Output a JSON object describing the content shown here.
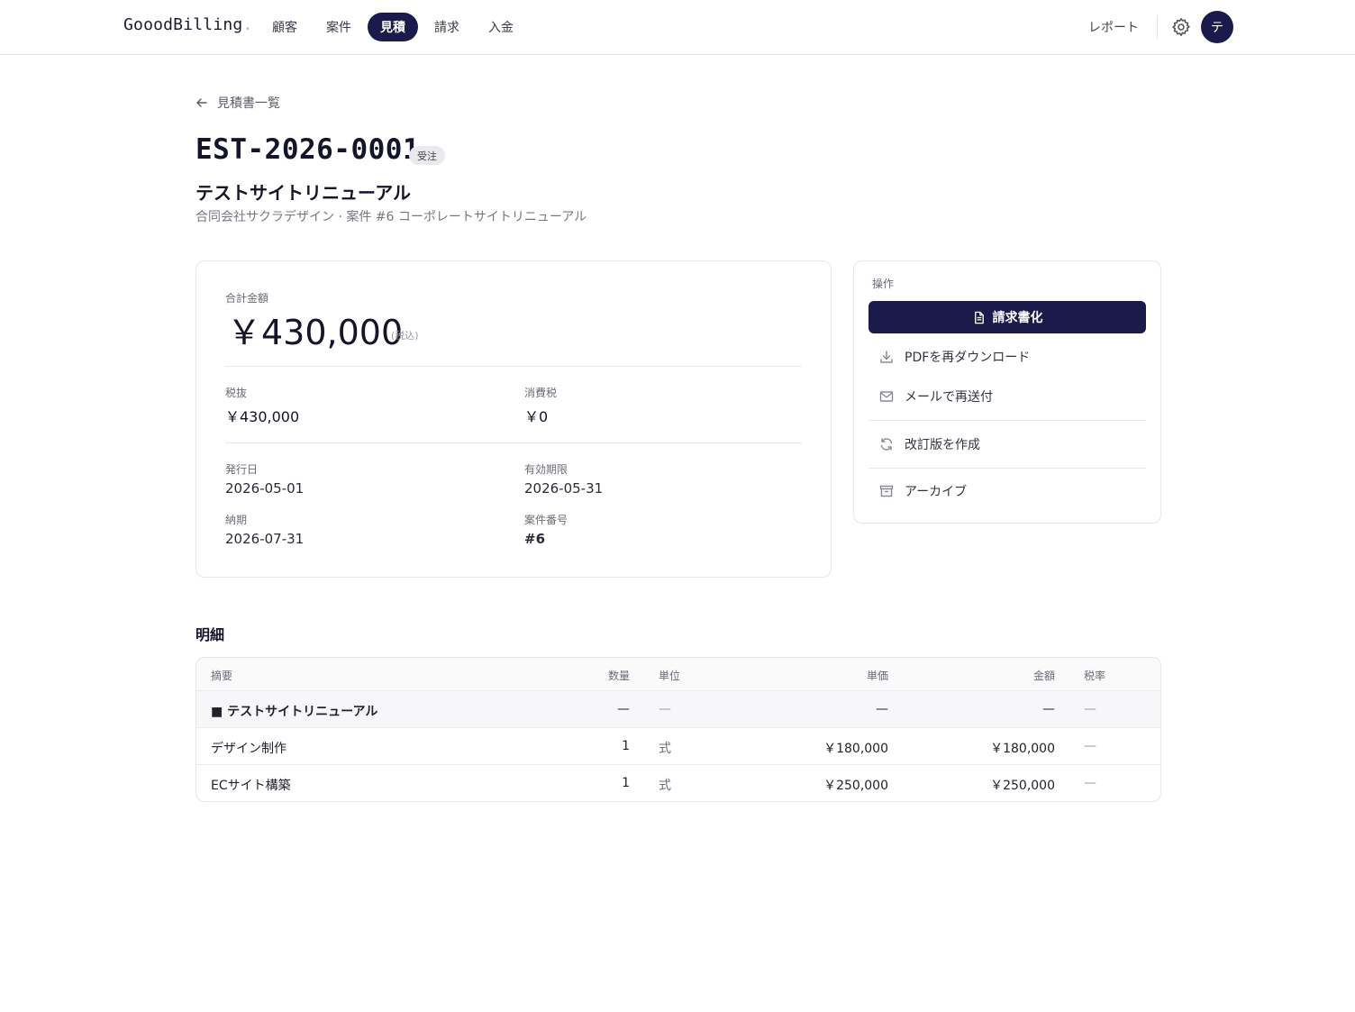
{
  "app": {
    "logo": "GooodBilling",
    "logo_dot": "."
  },
  "nav": {
    "items": [
      {
        "label": "顧客"
      },
      {
        "label": "案件"
      },
      {
        "label": "見積",
        "active": true
      },
      {
        "label": "請求"
      },
      {
        "label": "入金"
      }
    ],
    "report": "レポート",
    "settings_icon": "gear-icon",
    "avatar_initial": "テ"
  },
  "back": {
    "label": "見積書一覧",
    "icon": "arrow-left-icon"
  },
  "estimate": {
    "number": "EST-2026-0001",
    "status": "受注",
    "subject": "テストサイトリニューアル",
    "meta": "合同会社サクラデザイン · 案件 #6 コーポレートサイトリニューアル"
  },
  "summary": {
    "total_label": "合計金額",
    "total": "￥430,000",
    "tax_note": "(税込)",
    "subtotal_label": "税抜",
    "subtotal": "￥430,000",
    "tax_label": "消費税",
    "tax": "￥0",
    "issue_date_label": "発行日",
    "issue_date": "2026-05-01",
    "valid_until_label": "有効期限",
    "valid_until": "2026-05-31",
    "delivery_label": "納期",
    "delivery": "2026-07-31",
    "project_no_label": "案件番号",
    "project_no": "#6"
  },
  "actions": {
    "title": "操作",
    "primary": {
      "label": "請求書化",
      "icon": "document-icon"
    },
    "download_pdf": {
      "label": "PDFを再ダウンロード",
      "icon": "download-icon"
    },
    "resend_mail": {
      "label": "メールで再送付",
      "icon": "mail-icon"
    },
    "revise": {
      "label": "改訂版を作成",
      "icon": "refresh-icon"
    },
    "archive": {
      "label": "アーカイブ",
      "icon": "archive-icon"
    }
  },
  "items": {
    "title": "明細",
    "headers": {
      "description": "摘要",
      "qty": "数量",
      "unit": "単位",
      "unit_price": "単価",
      "amount": "金額",
      "tax_rate": "税率"
    },
    "group": {
      "description": "■ テストサイトリニューアル",
      "qty": "—",
      "unit": "—",
      "unit_price": "—",
      "amount": "—",
      "tax_rate": "—"
    },
    "rows": [
      {
        "description": "デザイン制作",
        "qty": "1",
        "unit": "式",
        "unit_price": "￥180,000",
        "amount": "￥180,000",
        "tax_rate": "—"
      },
      {
        "description": "ECサイト構築",
        "qty": "1",
        "unit": "式",
        "unit_price": "￥250,000",
        "amount": "￥250,000",
        "tax_rate": "—"
      }
    ]
  },
  "colors": {
    "brand_navy": "#1b1b4b",
    "border": "#e6e6eb",
    "muted_text": "#6b6b78"
  }
}
